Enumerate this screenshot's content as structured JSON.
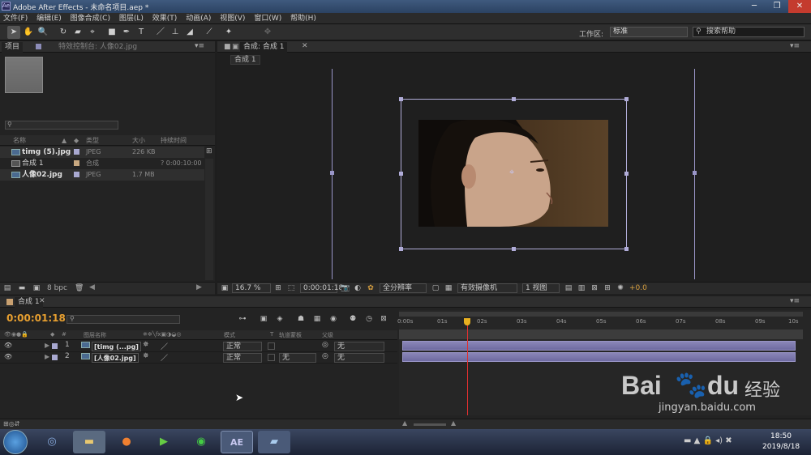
{
  "window": {
    "title": "Adobe After Effects - 未命名项目.aep *",
    "logo": "Ae"
  },
  "menu": [
    "文件(F)",
    "编辑(E)",
    "图像合成(C)",
    "图层(L)",
    "效果(T)",
    "动画(A)",
    "视图(V)",
    "窗口(W)",
    "帮助(H)"
  ],
  "toolbar": {
    "workspace_label": "工作区:",
    "workspace_value": "标准",
    "search_placeholder": "搜索帮助"
  },
  "project_panel": {
    "tab_project": "项目",
    "tab_effects": "特效控制台: 人像02.jpg",
    "columns": [
      "名称",
      "类型",
      "大小",
      "持续时间"
    ],
    "items": [
      {
        "name": "timg (5).jpg",
        "type": "JPEG",
        "size": "226 KB",
        "duration": ""
      },
      {
        "name": "合成 1",
        "type": "合成",
        "size": "",
        "duration": "? 0:00:10:00"
      },
      {
        "name": "人像02.jpg",
        "type": "JPEG",
        "size": "1.7 MB",
        "duration": ""
      }
    ],
    "bpc": "8 bpc"
  },
  "comp_panel": {
    "tab": "合成: 合成 1",
    "subtab": "合成 1",
    "zoom": "16.7 %",
    "timecode": "0:00:01:18",
    "resolution": "全分辨率",
    "camera": "有效摄像机",
    "views": "1 视图",
    "exposure": "+0.0"
  },
  "timeline": {
    "tab": "合成 1",
    "timecode": "0:00:01:18",
    "col_layer_name": "图层名称",
    "col_mode": "模式",
    "col_t": "T",
    "col_trkmat": "轨道蒙板",
    "col_parent": "父级",
    "layers": [
      {
        "num": "1",
        "name": "[timg (...pg]",
        "mode": "正常",
        "trkmat": "",
        "parent": "无"
      },
      {
        "num": "2",
        "name": "[人像02.jpg]",
        "mode": "正常",
        "trkmat": "无",
        "parent": "无"
      }
    ],
    "ticks": [
      "0:00s",
      "01s",
      "02s",
      "03s",
      "04s",
      "05s",
      "06s",
      "07s",
      "08s",
      "09s",
      "10s"
    ],
    "playhead_seconds": 1.72
  },
  "watermark": {
    "brand": "Bai",
    "brand2": "du",
    "cn": "经验",
    "url": "jingyan.baidu.com"
  },
  "taskbar": {
    "time": "18:50",
    "date": "2019/8/18",
    "ae_label": "AE"
  }
}
